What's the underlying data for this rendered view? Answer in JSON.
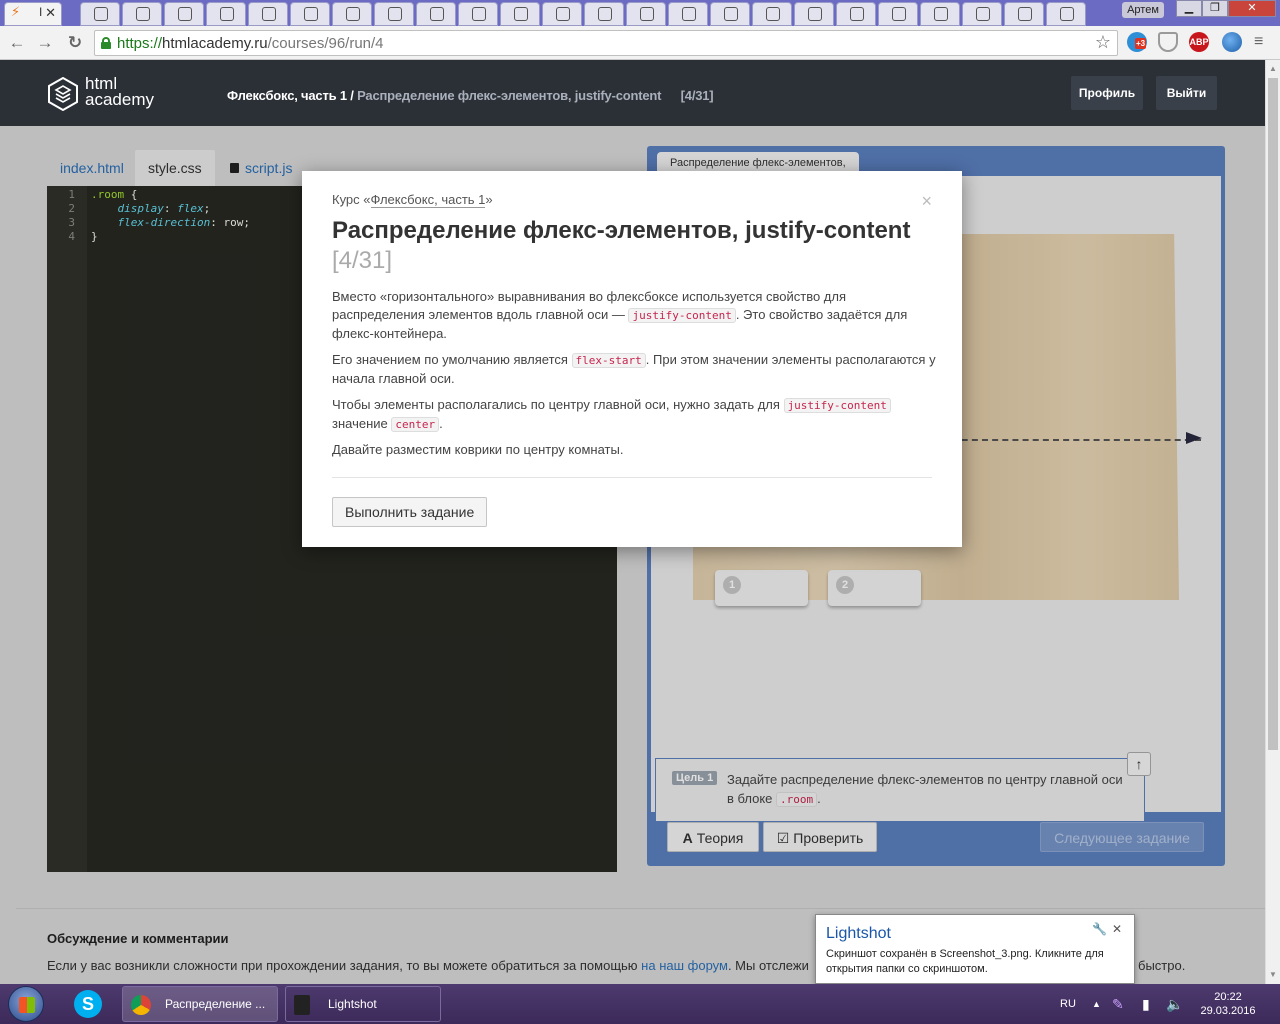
{
  "browser": {
    "win_user": "Артем",
    "url_scheme": "https://",
    "url_host": "htmlacademy.ru",
    "url_path": "/courses/96/run/4",
    "extensions": [
      {
        "name": "lightshot-extension-icon",
        "label": "+3",
        "color": "#2f8fd6"
      },
      {
        "name": "shield-icon",
        "label": "",
        "color": "#8a8a8a"
      },
      {
        "name": "adblock-plus-icon",
        "label": "ABP",
        "color": "#c7161c"
      },
      {
        "name": "globe-icon",
        "label": "",
        "color": "#2a6fb8"
      }
    ]
  },
  "header": {
    "logo_line1": "html",
    "logo_line2": "academy",
    "breadcrumb_course": "Флексбокс, часть 1 /",
    "breadcrumb_current": "Распределение флекс-элементов, justify-content",
    "breadcrumb_count": "[4/31]",
    "profile_label": "Профиль",
    "logout_label": "Выйти"
  },
  "editor": {
    "tabs": [
      "index.html",
      "style.css",
      "script.js"
    ],
    "lines": [
      "1",
      "2",
      "3",
      "4"
    ],
    "code": {
      "selector": ".room",
      "brace_open": " {",
      "prop1": "display",
      "val1": "flex",
      "prop2": "flex-direction",
      "val2": "row",
      "brace_close": "}"
    }
  },
  "preview": {
    "tab_label": "Распределение флекс-элементов,",
    "rugs": [
      "1",
      "2"
    ],
    "goal_badge": "Цель 1",
    "goal_text": "Задайте распределение флекс-элементов по центру главной оси в блоке",
    "goal_code": ".room",
    "goal_end": ".",
    "theory_label": "Теория",
    "check_label": "Проверить",
    "next_label": "Следующее задание"
  },
  "modal": {
    "course_prefix": "Курс «",
    "course_name": "Флексбокс, часть 1",
    "course_suffix": "»",
    "title": "Распределение флекс-элементов, justify-content",
    "progress": "[4/31]",
    "p1_a": "Вместо «горизонтального» выравнивания во флексбоксе используется свойство для распределения элементов вдоль главной оси —",
    "p1_code": "justify-content",
    "p1_b": ". Это свойство задаётся для флекс-контейнера.",
    "p2_a": "Его значением по умолчанию является",
    "p2_code": "flex-start",
    "p2_b": ". При этом значении элементы располагаются у начала главной оси.",
    "p3_a": "Чтобы элементы располагались по центру главной оси, нужно задать для",
    "p3_code1": "justify-content",
    "p3_mid": "значение",
    "p3_code2": "center",
    "p3_end": ".",
    "p4": "Давайте разместим коврики по центру комнаты.",
    "button_label": "Выполнить задание"
  },
  "discussion": {
    "title": "Обсуждение и комментарии",
    "text_a": "Если у вас возникли сложности при прохождении задания, то вы можете обратиться за помощью",
    "link": "на наш форум",
    "text_b": ". Мы отслежи",
    "text_tail": "но быстро."
  },
  "notification": {
    "title": "Lightshot",
    "body": "Скриншот сохранён в Screenshot_3.png. Кликните для открытия папки со скриншотом."
  },
  "taskbar": {
    "items": [
      "Распределение ...",
      "Lightshot"
    ],
    "lang": "RU",
    "time": "20:22",
    "date": "29.03.2016"
  }
}
